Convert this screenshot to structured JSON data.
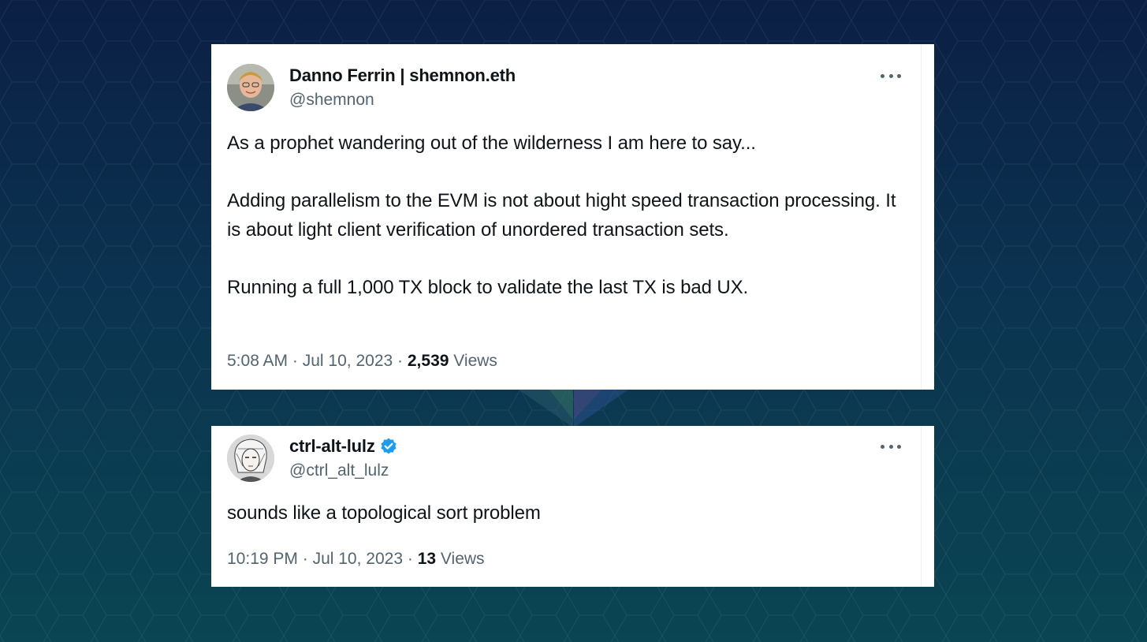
{
  "tweets": [
    {
      "display_name": "Danno Ferrin | shemnon.eth",
      "handle": "@shemnon",
      "verified": false,
      "paragraphs": [
        "As a prophet wandering out of the wilderness I am here to say...",
        "Adding parallelism to the EVM is not about hight speed transaction processing.  It is about light client verification of unordered transaction sets.",
        "Running a full 1,000 TX block to validate the last TX is bad UX."
      ],
      "time": "5:08 AM",
      "date": "Jul 10, 2023",
      "separator": "·",
      "views_count": "2,539",
      "views_label": "Views",
      "more_icon": "more-horizontal-icon"
    },
    {
      "display_name": "ctrl-alt-lulz",
      "handle": "@ctrl_alt_lulz",
      "verified": true,
      "paragraphs": [
        "sounds like a topological sort problem"
      ],
      "time": "10:19 PM",
      "date": "Jul 10, 2023",
      "separator": "·",
      "views_count": "13",
      "views_label": "Views",
      "more_icon": "more-horizontal-icon"
    }
  ],
  "colors": {
    "text_primary": "#0f1419",
    "text_secondary": "#536471",
    "verified_blue": "#1d9bf0",
    "background_top": "#0b1f44",
    "background_bottom": "#0a4552"
  }
}
